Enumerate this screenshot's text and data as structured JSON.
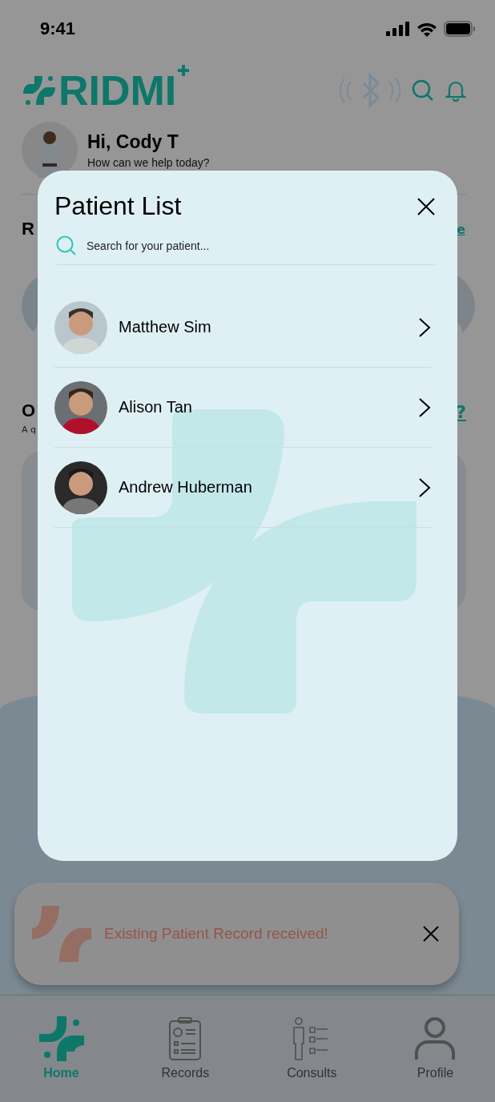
{
  "status_bar": {
    "time": "9:41"
  },
  "header": {
    "logo_text": "RIDMI"
  },
  "greeting": {
    "title": "Hi, Cody T",
    "subtitle": "How can we help today?"
  },
  "section_1": {
    "heading": "R",
    "link": "e"
  },
  "section_2": {
    "heading": "O",
    "subtitle": "A q",
    "link": "?"
  },
  "toast": {
    "message": "Existing Patient Record received!"
  },
  "bottom_nav": [
    {
      "label": "Home",
      "kind": "home",
      "selected": true
    },
    {
      "label": "Records",
      "kind": "records",
      "selected": false
    },
    {
      "label": "Consults",
      "kind": "consults",
      "selected": false
    },
    {
      "label": "Profile",
      "kind": "profile",
      "selected": false
    }
  ],
  "modal": {
    "title": "Patient List",
    "search": {
      "placeholder": "Search for your patient..."
    },
    "patients": [
      {
        "name": "Matthew Sim",
        "kind": "picture"
      },
      {
        "name": "Alison Tan",
        "kind": "picture"
      },
      {
        "name": "Andrew Huberman",
        "kind": "picture"
      }
    ]
  }
}
